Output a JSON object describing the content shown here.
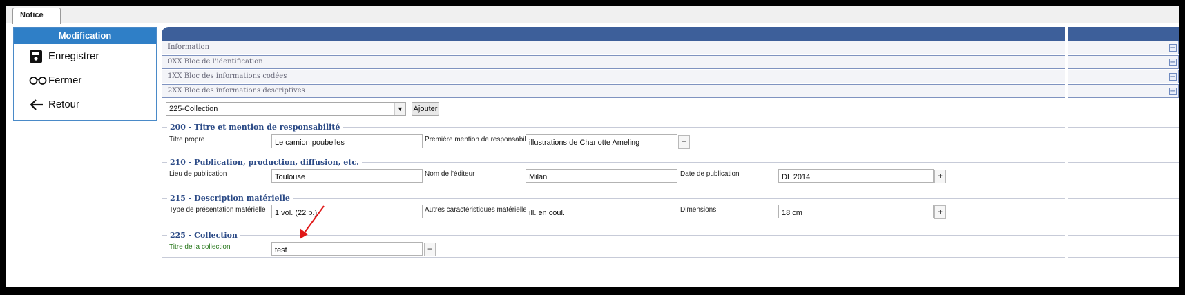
{
  "tabs": [
    {
      "label": "Notice"
    }
  ],
  "menu": {
    "header": "Modification",
    "items": [
      {
        "label": "Enregistrer",
        "icon": "save-icon"
      },
      {
        "label": "Fermer",
        "icon": "glasses-icon"
      },
      {
        "label": "Retour",
        "icon": "arrow-left-icon"
      }
    ]
  },
  "sections": [
    {
      "label": "Information",
      "toggle": "+"
    },
    {
      "label": "0XX Bloc de l'identification",
      "toggle": "+"
    },
    {
      "label": "1XX Bloc des informations codées",
      "toggle": "+"
    },
    {
      "label": "2XX Bloc des informations descriptives",
      "toggle": "−"
    }
  ],
  "field_select": {
    "value": "225-Collection",
    "arrow": "▼",
    "add_label": "Ajouter"
  },
  "plus_symbol": "+",
  "groups": {
    "g200": {
      "title": "200 - Titre et mention de responsabilité",
      "titre_propre_label": "Titre propre",
      "titre_propre_value": "Le camion poubelles",
      "mention_label": "Première mention de responsabilité",
      "mention_value": "illustrations de Charlotte Ameling"
    },
    "g210": {
      "title": "210 - Publication, production, diffusion, etc.",
      "lieu_label": "Lieu de publication",
      "lieu_value": "Toulouse",
      "editeur_label": "Nom de l'éditeur",
      "editeur_value": "Milan",
      "date_label": "Date de publication",
      "date_value": "DL 2014"
    },
    "g215": {
      "title": "215 - Description matérielle",
      "type_label": "Type de présentation matérielle",
      "type_value": "1 vol. (22 p.)",
      "autres_label": "Autres caractéristiques matérielles",
      "autres_value": "ill. en coul.",
      "dim_label": "Dimensions",
      "dim_value": "18 cm"
    },
    "g225": {
      "title": "225 - Collection",
      "titre_coll_label": "Titre de la collection",
      "titre_coll_value": "test"
    }
  },
  "colors": {
    "accent": "#2f7fc7",
    "section_border": "#7f93c0",
    "annotation_arrow": "#e01818"
  }
}
